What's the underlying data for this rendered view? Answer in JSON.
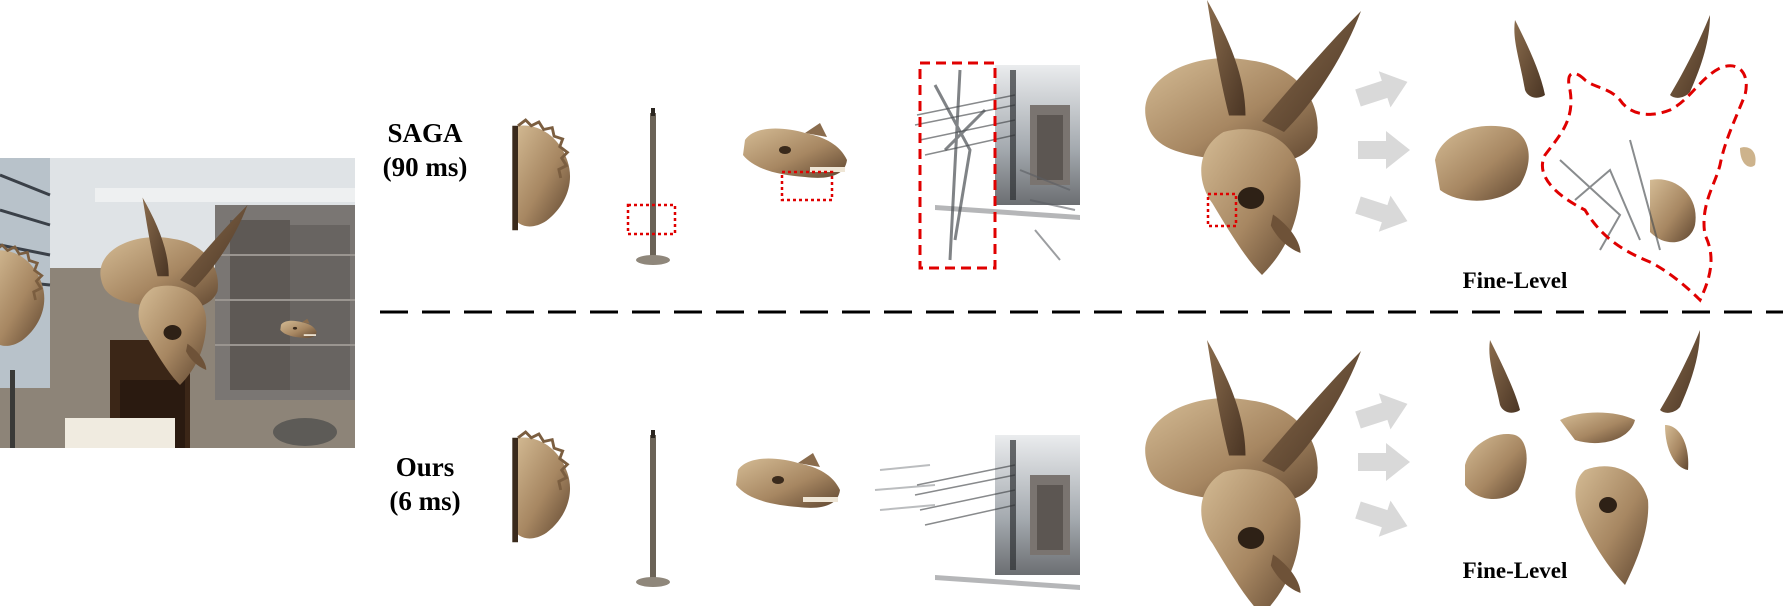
{
  "figure": {
    "rows": [
      {
        "method": "SAGA",
        "time": "(90 ms)"
      },
      {
        "method": "Ours",
        "time": "(6 ms)"
      }
    ],
    "fine_level_label": "Fine-Level"
  },
  "colors": {
    "bone": "#a78762",
    "bone_light": "#cdb38c",
    "bone_dark": "#5f4630",
    "highlight_box": "#e00000",
    "arrow": "#d9d9d9",
    "divider": "#000000"
  }
}
